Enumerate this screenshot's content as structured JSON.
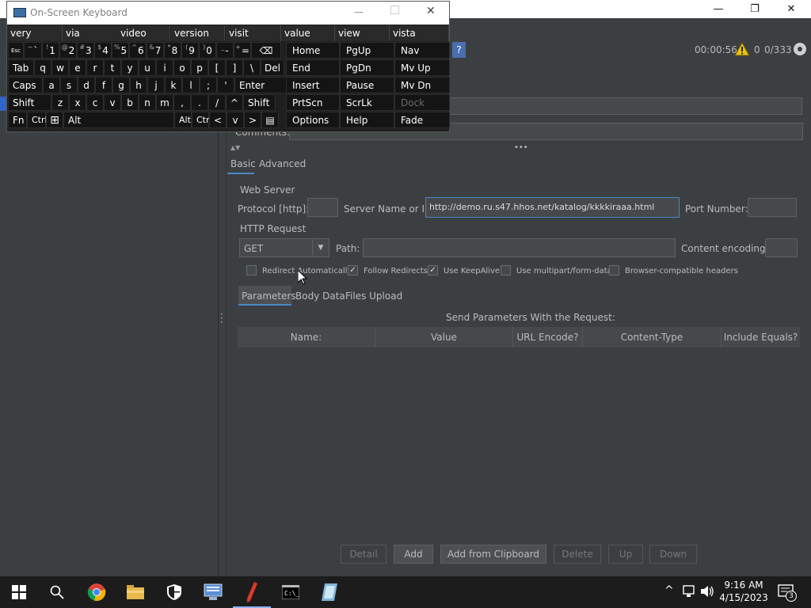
{
  "app": {
    "window_controls": {
      "minimize": "—",
      "maximize": "❐",
      "close": "✕"
    },
    "toolbar": {
      "timer": "00:00:56",
      "warnings": "0",
      "threads": "0/333"
    },
    "comments_label": "Comments:",
    "tabs": {
      "basic": "Basic",
      "advanced": "Advanced"
    },
    "web_server": {
      "section": "Web Server",
      "protocol_label": "Protocol [http]:",
      "protocol_value": "",
      "server_label": "Server Name or IP:",
      "server_value": "http://demo.ru.s47.hhos.net/katalog/kkkkiraaa.html",
      "port_label": "Port Number:",
      "port_value": ""
    },
    "http_request": {
      "section": "HTTP Request",
      "method": "GET",
      "path_label": "Path:",
      "path_value": "",
      "encoding_label": "Content encoding:",
      "encoding_value": ""
    },
    "options": [
      {
        "label": "Redirect Automatically",
        "checked": false
      },
      {
        "label": "Follow Redirects",
        "checked": true
      },
      {
        "label": "Use KeepAlive",
        "checked": true
      },
      {
        "label": "Use multipart/form-data",
        "checked": false
      },
      {
        "label": "Browser-compatible headers",
        "checked": false
      }
    ],
    "subtabs": {
      "parameters": "Parameters",
      "body": "Body Data",
      "files": "Files Upload"
    },
    "params_title": "Send Parameters With the Request:",
    "columns": [
      "Name:",
      "Value",
      "URL Encode?",
      "Content-Type",
      "Include Equals?"
    ],
    "buttons": {
      "detail": "Detail",
      "add": "Add",
      "clipboard": "Add from Clipboard",
      "delete": "Delete",
      "up": "Up",
      "down": "Down"
    }
  },
  "osk": {
    "title": "On-Screen Keyboard",
    "suggestions": [
      "very",
      "via",
      "video",
      "version",
      "visit",
      "value",
      "view",
      "vista"
    ],
    "nav_keys": [
      [
        "Home",
        "PgUp",
        "Nav"
      ],
      [
        "End",
        "PgDn",
        "Mv Up"
      ],
      [
        "Insert",
        "Pause",
        "Mv Dn"
      ],
      [
        "PrtScn",
        "ScrLk",
        "Dock"
      ],
      [
        "Options",
        "Help",
        "Fade"
      ]
    ],
    "row1": [
      {
        "s": "Esc",
        "m": ""
      },
      {
        "s": "~",
        "m": "`"
      },
      {
        "s": "!",
        "m": "1"
      },
      {
        "s": "@",
        "m": "2"
      },
      {
        "s": "#",
        "m": "3"
      },
      {
        "s": "$",
        "m": "4"
      },
      {
        "s": "%",
        "m": "5"
      },
      {
        "s": "^",
        "m": "6"
      },
      {
        "s": "&",
        "m": "7"
      },
      {
        "s": "*",
        "m": "8"
      },
      {
        "s": "(",
        "m": "9"
      },
      {
        "s": ")",
        "m": "0"
      },
      {
        "s": "_",
        "m": "-"
      },
      {
        "s": "+",
        "m": "="
      },
      {
        "s": "",
        "m": "⌫"
      }
    ],
    "row2": [
      "Tab",
      "q",
      "w",
      "e",
      "r",
      "t",
      "y",
      "u",
      "i",
      "o",
      "p",
      "[",
      "]",
      "\\",
      "Del"
    ],
    "row3": [
      "Caps",
      "a",
      "s",
      "d",
      "f",
      "g",
      "h",
      "j",
      "k",
      "l",
      ";",
      "'",
      "Enter"
    ],
    "row4": [
      "Shift",
      "z",
      "x",
      "c",
      "v",
      "b",
      "n",
      "m",
      ",",
      ".",
      "/",
      "^",
      "Shift"
    ],
    "row5": [
      "Fn",
      "Ctrl",
      "⊞",
      "Alt",
      "Alt",
      "Ctrl",
      "<",
      "v",
      ">",
      "▤"
    ]
  },
  "taskbar": {
    "time": "9:16 AM",
    "date": "4/15/2023",
    "notifications": "3"
  }
}
